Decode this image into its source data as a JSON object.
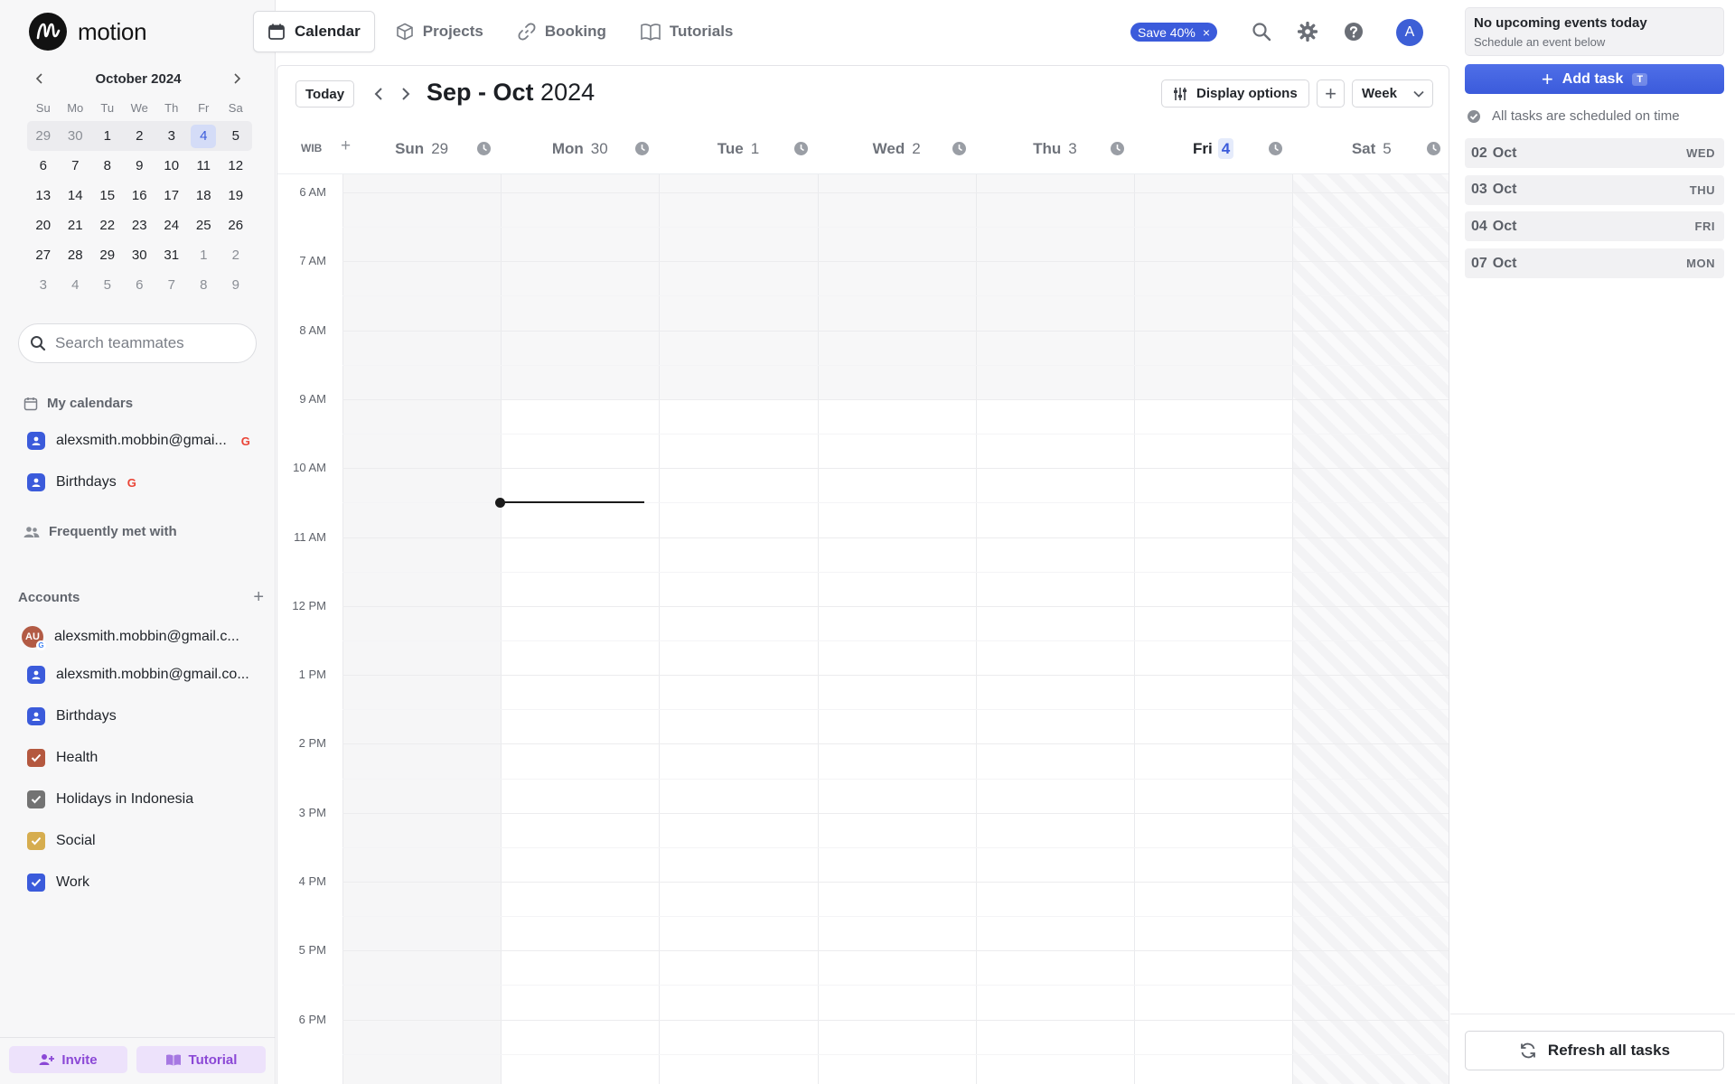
{
  "app": {
    "name": "motion"
  },
  "nav": {
    "tabs": [
      {
        "label": "Calendar",
        "icon": "calendar-icon",
        "active": true
      },
      {
        "label": "Projects",
        "icon": "cube-icon",
        "active": false
      },
      {
        "label": "Booking",
        "icon": "link-icon",
        "active": false
      },
      {
        "label": "Tutorials",
        "icon": "book-icon",
        "active": false
      }
    ],
    "save_badge": "Save 40%",
    "save_badge_close": "×",
    "avatar_initial": "A"
  },
  "mini_calendar": {
    "title": "October 2024",
    "weekdays": [
      "Su",
      "Mo",
      "Tu",
      "We",
      "Th",
      "Fr",
      "Sa"
    ],
    "weeks": [
      [
        "29",
        "30",
        "1",
        "2",
        "3",
        "4",
        "5"
      ],
      [
        "6",
        "7",
        "8",
        "9",
        "10",
        "11",
        "12"
      ],
      [
        "13",
        "14",
        "15",
        "16",
        "17",
        "18",
        "19"
      ],
      [
        "20",
        "21",
        "22",
        "23",
        "24",
        "25",
        "26"
      ],
      [
        "27",
        "28",
        "29",
        "30",
        "31",
        "1",
        "2"
      ],
      [
        "3",
        "4",
        "5",
        "6",
        "7",
        "8",
        "9"
      ]
    ],
    "today": "4"
  },
  "sidebar": {
    "search_placeholder": "Search teammates",
    "my_calendars_label": "My calendars",
    "my_calendars": [
      {
        "label": "alexsmith.mobbin@gmai...",
        "google": "G"
      },
      {
        "label": "Birthdays",
        "google": "G"
      }
    ],
    "frequently_met_label": "Frequently met with",
    "accounts_label": "Accounts",
    "accounts": [
      {
        "label": "alexsmith.mobbin@gmail.c...",
        "type": "avatar",
        "initials": "AU"
      },
      {
        "label": "alexsmith.mobbin@gmail.co...",
        "type": "person",
        "color": "#3b5bdb"
      },
      {
        "label": "Birthdays",
        "type": "person",
        "color": "#3b5bdb"
      },
      {
        "label": "Health",
        "type": "check",
        "color": "#b4583f"
      },
      {
        "label": "Holidays in Indonesia",
        "type": "check",
        "color": "#737373"
      },
      {
        "label": "Social",
        "type": "check",
        "color": "#d6ad4f"
      },
      {
        "label": "Work",
        "type": "check",
        "color": "#3b5bdb"
      }
    ],
    "invite_label": "Invite",
    "tutorial_label": "Tutorial"
  },
  "calendar": {
    "today_button": "Today",
    "range_bold": "Sep - Oct",
    "range_year": "2024",
    "display_options": "Display options",
    "add_button": "+",
    "view_select": "Week",
    "timezone": "WIB",
    "timezone_add": "+",
    "days": [
      {
        "name": "Sun",
        "date": "29",
        "today": false
      },
      {
        "name": "Mon",
        "date": "30",
        "today": false
      },
      {
        "name": "Tue",
        "date": "1",
        "today": false
      },
      {
        "name": "Wed",
        "date": "2",
        "today": false
      },
      {
        "name": "Thu",
        "date": "3",
        "today": false
      },
      {
        "name": "Fri",
        "date": "4",
        "today": true
      },
      {
        "name": "Sat",
        "date": "5",
        "today": false
      }
    ],
    "hours": [
      "6 AM",
      "7 AM",
      "8 AM",
      "9 AM",
      "10 AM",
      "11 AM",
      "12 PM",
      "1 PM",
      "2 PM",
      "3 PM",
      "4 PM",
      "5 PM",
      "6 PM"
    ]
  },
  "right_panel": {
    "upcoming_title": "No upcoming events today",
    "upcoming_sub": "Schedule an event below",
    "add_task_label": "Add task",
    "add_task_shortcut": "T",
    "scheduled_status": "All tasks are scheduled on time",
    "dates": [
      {
        "day": "02",
        "month": "Oct",
        "dow": "WED"
      },
      {
        "day": "03",
        "month": "Oct",
        "dow": "THU"
      },
      {
        "day": "04",
        "month": "Oct",
        "dow": "FRI"
      },
      {
        "day": "07",
        "month": "Oct",
        "dow": "MON"
      }
    ],
    "refresh_label": "Refresh all tasks"
  },
  "colors": {
    "accent": "#3b5bdb",
    "purple": "#8b48d6",
    "purple_bg": "#ede2fb"
  }
}
